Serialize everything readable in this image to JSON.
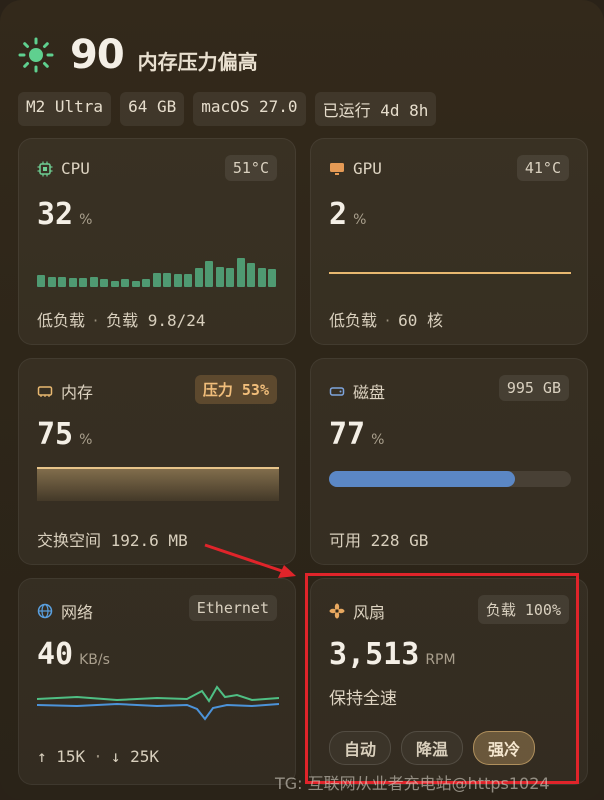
{
  "header": {
    "score": "90",
    "status": "内存压力偏高"
  },
  "chips": [
    "M2 Ultra",
    "64 GB",
    "macOS 27.0",
    "已运行 4d 8h"
  ],
  "cpu": {
    "title": "CPU",
    "temp": "51°C",
    "value": "32",
    "unit": "%",
    "footer_state": "低负载",
    "footer_sep": "·",
    "footer_load": "负载 9.8/24",
    "history_percent": [
      18,
      16,
      16,
      14,
      14,
      15,
      12,
      10,
      12,
      10,
      12,
      22,
      22,
      20,
      20,
      30,
      40,
      32,
      30,
      45,
      38,
      30,
      28
    ]
  },
  "gpu": {
    "title": "GPU",
    "temp": "41°C",
    "value": "2",
    "unit": "%",
    "footer_state": "低负载",
    "footer_sep": "·",
    "footer_cores": "60 核"
  },
  "memory": {
    "title": "内存",
    "pressure": "压力 53%",
    "value": "75",
    "unit": "%",
    "footer": "交换空间 192.6 MB"
  },
  "disk": {
    "title": "磁盘",
    "capacity": "995 GB",
    "value": "77",
    "unit": "%",
    "used_fraction": 0.77,
    "footer": "可用 228 GB"
  },
  "network": {
    "title": "网络",
    "interface": "Ethernet",
    "value": "40",
    "unit": "KB/s",
    "footer_up": "↑ 15K",
    "footer_sep": "·",
    "footer_down": "↓ 25K"
  },
  "fan": {
    "title": "风扇",
    "load": "负载 100%",
    "value": "3,513",
    "unit": "RPM",
    "status": "保持全速",
    "modes": [
      "自动",
      "降温",
      "强冷"
    ],
    "active_mode": "强冷"
  },
  "watermark": "TG: 互联网从业者充电站@https1024",
  "colors": {
    "accent_green": "#4f9a72",
    "accent_amber": "#e8b870",
    "disk_blue": "#5b87c5",
    "highlight_red": "#e0242a"
  }
}
